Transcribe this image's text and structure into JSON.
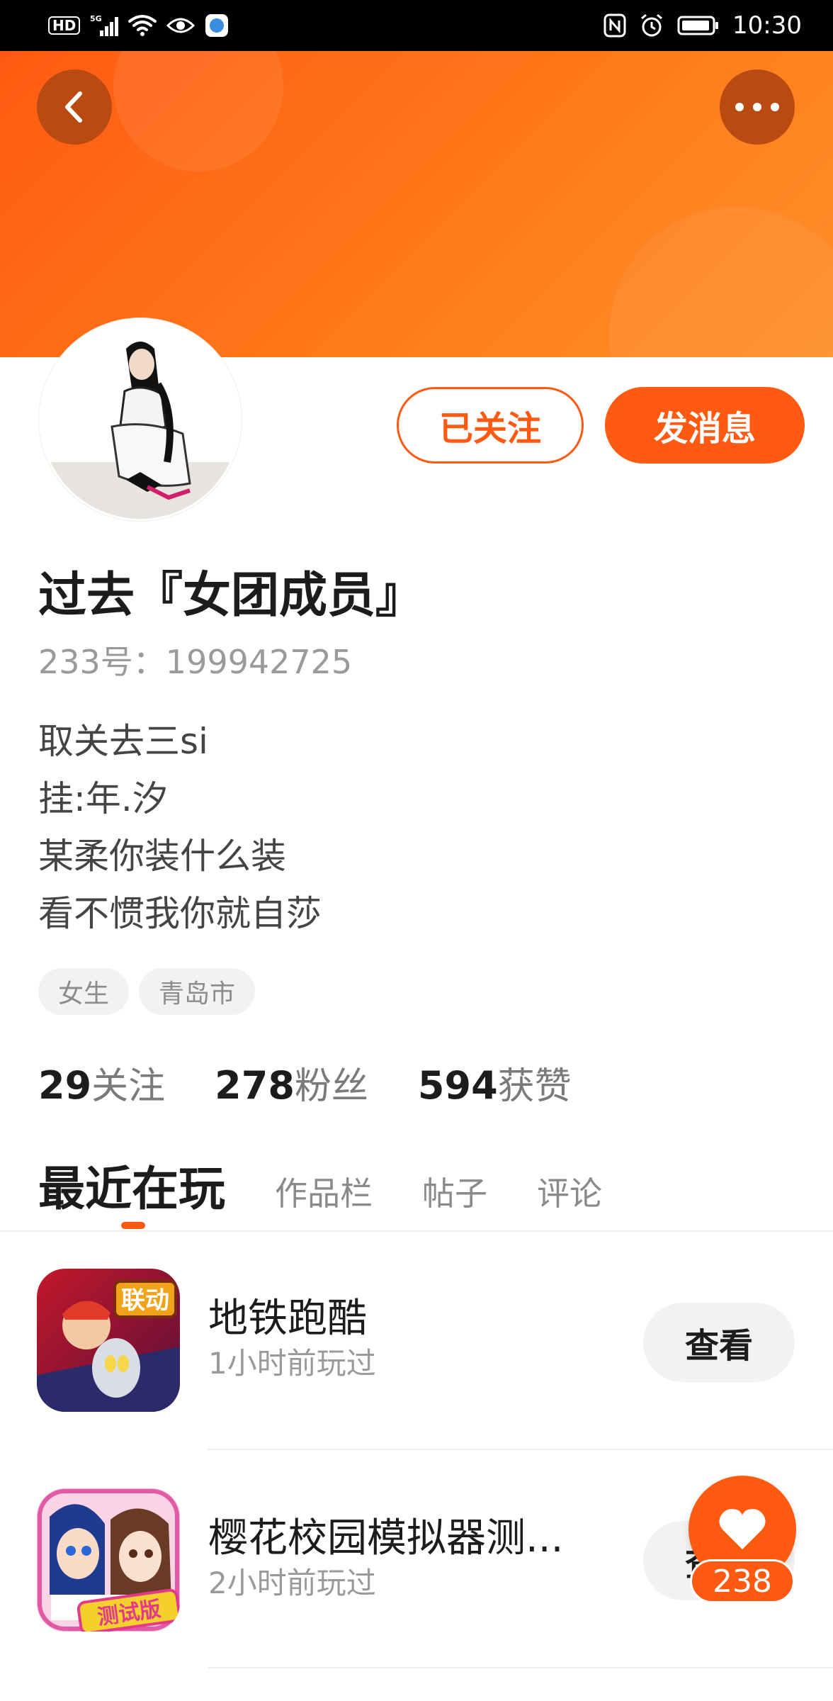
{
  "status_bar": {
    "hd": "HD",
    "network": "5G",
    "time": "10:30"
  },
  "header": {
    "back_icon": "chevron-left-icon",
    "more_icon": "more-horizontal-icon"
  },
  "profile": {
    "follow_button": "已关注",
    "message_button": "发消息",
    "username": "过去『女团成员』",
    "uid": "233号：199942725",
    "bio": [
      "取关去三si",
      "挂:年.汐",
      "某柔你装什么装",
      "看不惯我你就自莎"
    ],
    "tags": [
      "女生",
      "青岛市"
    ],
    "stats": [
      {
        "num": "29",
        "label": "关注"
      },
      {
        "num": "278",
        "label": "粉丝"
      },
      {
        "num": "594",
        "label": "获赞"
      }
    ]
  },
  "tabs": [
    {
      "label": "最近在玩",
      "active": true
    },
    {
      "label": "作品栏",
      "active": false
    },
    {
      "label": "帖子",
      "active": false
    },
    {
      "label": "评论",
      "active": false
    }
  ],
  "games": [
    {
      "title": "地铁跑酷",
      "subtitle": "1小时前玩过",
      "button": "查看",
      "badge": "联动"
    },
    {
      "title": "樱花校园模拟器测...",
      "subtitle": "2小时前玩过",
      "button": "查看",
      "badge": "测试版"
    }
  ],
  "like": {
    "count": "238",
    "icon": "heart-icon"
  },
  "colors": {
    "accent": "#ff5a12",
    "header_gradient_end": "#ff8f2a"
  }
}
